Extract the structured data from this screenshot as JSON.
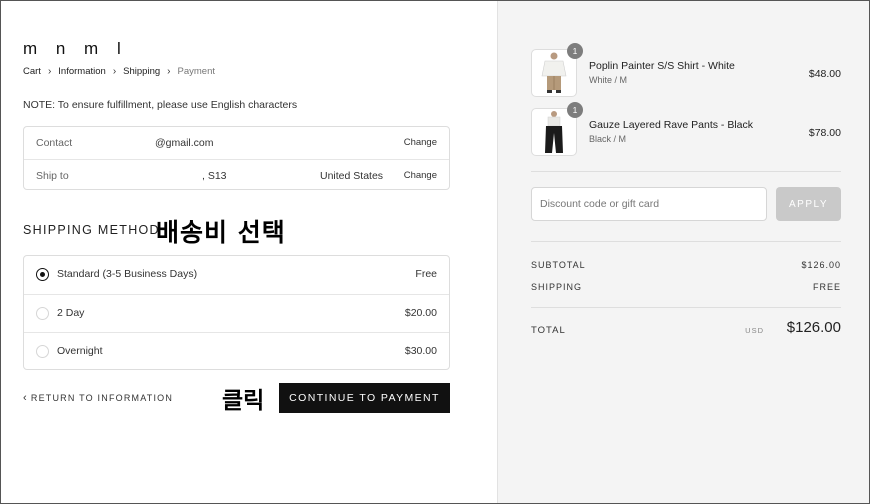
{
  "brand": {
    "logo": "m n m l"
  },
  "breadcrumb": [
    "Cart",
    "Information",
    "Shipping",
    "Payment"
  ],
  "note": "NOTE: To ensure fulfillment, please use English characters",
  "contact": {
    "label": "Contact",
    "value": "@gmail.com",
    "change": "Change"
  },
  "ship_to": {
    "label": "Ship to",
    "value": ", S13",
    "country": "United States",
    "change": "Change"
  },
  "shipping_method": {
    "title": "SHIPPING METHOD",
    "options": [
      {
        "label": "Standard (3-5 Business Days)",
        "price": "Free",
        "selected": true
      },
      {
        "label": "2 Day",
        "price": "$20.00",
        "selected": false
      },
      {
        "label": "Overnight",
        "price": "$30.00",
        "selected": false
      }
    ]
  },
  "annotations": {
    "select_shipping": "배송비 선택",
    "click": "클릭"
  },
  "actions": {
    "return": "RETURN TO INFORMATION",
    "continue": "CONTINUE TO PAYMENT"
  },
  "cart": {
    "items": [
      {
        "name": "Poplin Painter S/S Shirt - White",
        "variant": "White / M",
        "price": "$48.00",
        "qty": "1"
      },
      {
        "name": "Gauze Layered Rave Pants - Black",
        "variant": "Black / M",
        "price": "$78.00",
        "qty": "1"
      }
    ],
    "discount_placeholder": "Discount code or gift card",
    "apply": "APPLY",
    "subtotal_label": "SUBTOTAL",
    "subtotal": "$126.00",
    "shipping_label": "SHIPPING",
    "shipping": "FREE",
    "total_label": "TOTAL",
    "currency": "USD",
    "total": "$126.00"
  }
}
